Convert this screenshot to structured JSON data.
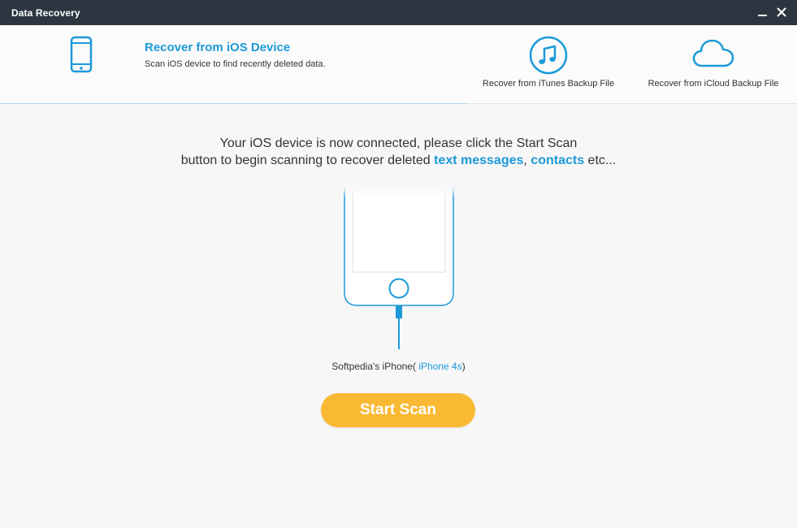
{
  "window": {
    "title": "Data Recovery",
    "minimize_icon": "minimize-icon",
    "close_icon": "close-icon"
  },
  "header": {
    "active_tab": {
      "icon": "phone-icon",
      "title": "Recover from iOS Device",
      "subtitle": "Scan iOS device to find recently deleted data."
    },
    "tabs": [
      {
        "icon": "itunes-music-icon",
        "label": "Recover from iTunes Backup File"
      },
      {
        "icon": "icloud-icon",
        "label": "Recover from iCloud Backup File"
      }
    ]
  },
  "main": {
    "message_line1": "Your iOS device is now connected, please click the Start Scan",
    "message_line2_prefix": "button to begin scanning to recover deleted",
    "link_text_messages": "text messages",
    "separator": ",",
    "link_contacts": "contacts",
    "message_suffix": "etc...",
    "device_owner": "Softpedia's iPhone(",
    "device_model": "iPhone 4s",
    "device_close": ")",
    "start_button": "Start Scan"
  },
  "colors": {
    "accent": "#1c9ad8",
    "titlebar": "#2b3640",
    "button": "#f9b933",
    "background": "#f7f7f8"
  }
}
